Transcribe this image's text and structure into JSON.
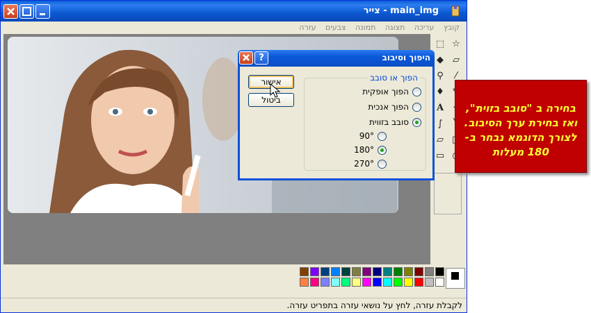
{
  "window": {
    "title": "main_img - צייר",
    "menu": [
      "קובץ",
      "עריכה",
      "תצוגה",
      "תמונה",
      "צבעים",
      "עזרה"
    ]
  },
  "dialog": {
    "title": "היפוך וסיבוב",
    "ok_label": "אישור",
    "cancel_label": "ביטול",
    "group_label": "הפוך או סובב",
    "options": [
      {
        "label": "הפוך אופקית",
        "checked": false
      },
      {
        "label": "הפוך אנכית",
        "checked": false
      },
      {
        "label": "סובב בזווית",
        "checked": true
      }
    ],
    "angles": [
      {
        "label": "90°",
        "checked": false
      },
      {
        "label": "180°",
        "checked": true
      },
      {
        "label": "270°",
        "checked": false
      }
    ]
  },
  "status": {
    "text": "לקבלת עזרה, לחץ על נושאי עזרה בתפריט עזרה."
  },
  "callout": {
    "line1": "בחירה ב \"סובב בזוית\",",
    "line2": "ואז בחירת ערך הסיבוב.",
    "line3": "לצורך הדוגמא נבחר ב-",
    "line4": "180 מעלות"
  },
  "palette": {
    "row1": [
      "#000000",
      "#808080",
      "#800000",
      "#808000",
      "#008000",
      "#008080",
      "#000080",
      "#800080",
      "#808040",
      "#004040",
      "#0080ff",
      "#004080",
      "#8000ff",
      "#804000"
    ],
    "row2": [
      "#ffffff",
      "#c0c0c0",
      "#ff0000",
      "#ffff00",
      "#00ff00",
      "#00ffff",
      "#0000ff",
      "#ff00ff",
      "#ffff80",
      "#00ff80",
      "#80ffff",
      "#8080ff",
      "#ff0080",
      "#ff8040"
    ]
  }
}
